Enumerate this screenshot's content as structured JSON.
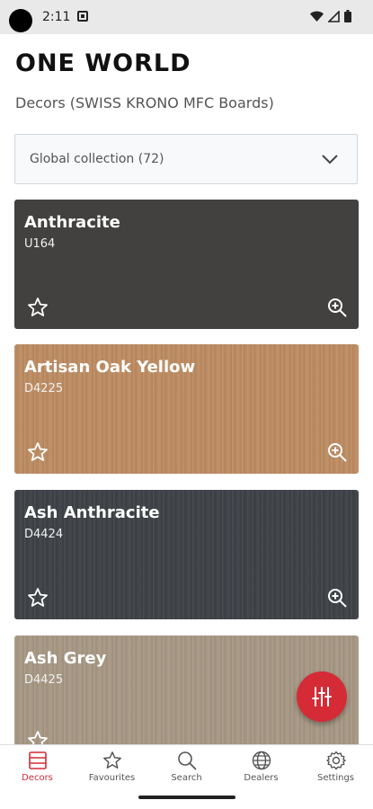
{
  "status_bar": {
    "time": "2:11"
  },
  "header": {
    "title": "ONE WORLD",
    "subtitle": "Decors (SWISS KRONO MFC Boards)"
  },
  "collection_select": {
    "value": "Global collection (72)"
  },
  "decors": [
    {
      "name": "Anthracite",
      "code": "U164",
      "color": "#424140"
    },
    {
      "name": "Artisan Oak Yellow",
      "code": "D4225",
      "color": "#c08e63"
    },
    {
      "name": "Ash Anthracite",
      "code": "D4424",
      "color": "#3e4247"
    },
    {
      "name": "Ash Grey",
      "code": "D4425",
      "color": "#a99a86"
    }
  ],
  "bottom_nav": {
    "items": [
      {
        "label": "Decors",
        "icon": "decors-icon",
        "active": true
      },
      {
        "label": "Favourites",
        "icon": "star-icon",
        "active": false
      },
      {
        "label": "Search",
        "icon": "search-icon",
        "active": false
      },
      {
        "label": "Dealers",
        "icon": "globe-icon",
        "active": false
      },
      {
        "label": "Settings",
        "icon": "gear-icon",
        "active": false
      }
    ]
  },
  "colors": {
    "accent": "#d42b36",
    "inactive": "#555555"
  }
}
